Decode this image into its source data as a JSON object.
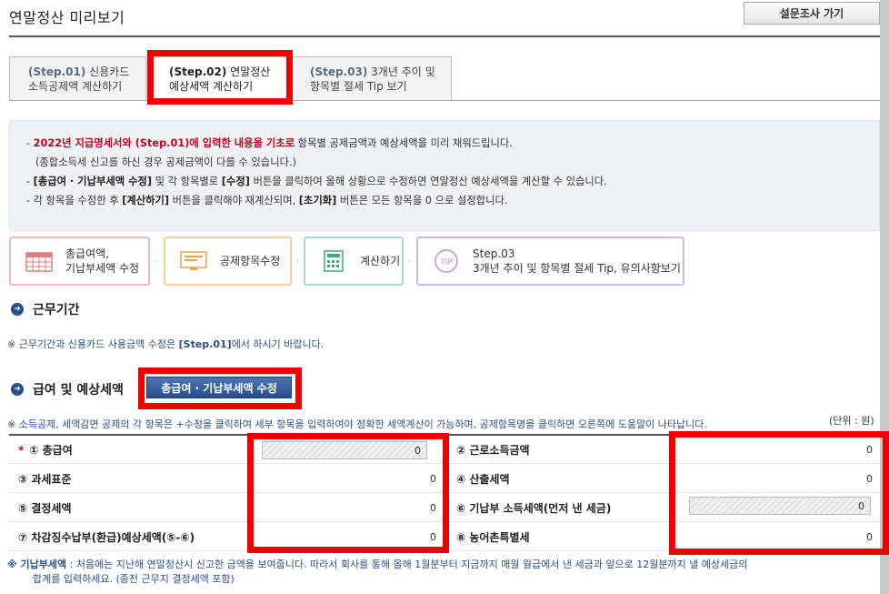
{
  "page": {
    "title": "연말정산 미리보기",
    "survey_button": "설문조사 가기"
  },
  "tabs": [
    {
      "step": "(Step.01)",
      "line1": "신용카드",
      "line2": "소득공제액 계산하기"
    },
    {
      "step": "(Step.02)",
      "line1": "연말정산",
      "line2": "예상세액 계산하기"
    },
    {
      "step": "(Step.03)",
      "line1": "3개년 추이 및",
      "line2": "항목별 절세 Tip 보기"
    }
  ],
  "notice": {
    "l1_red": "2022년 지급명세서와 (Step.01)에 입력한 내용을 기초로",
    "l1_rest": " 항목별 공제금액과 예상세액을 미리 채워드립니다.",
    "l2": "(종합소득세 신고를 하신 경우 공제금액이 다를 수 있습니다.)",
    "l3_b1": "[총급여 · 기납부세액 수정]",
    "l3_m1": " 및 각 항목별로 ",
    "l3_b2": "[수정]",
    "l3_rest": " 버튼을 클릭하여 올해 상황으로 수정하면 연말정산 예상세액을 계산할 수 있습니다.",
    "l4_a": "각 항목을 수정한 후 ",
    "l4_b1": "[계산하기]",
    "l4_m": " 버튼을 클릭해야 재계산되며, ",
    "l4_b2": "[초기화]",
    "l4_rest": " 버튼은 모든 항목을 0 으로 설정합니다."
  },
  "steps": [
    {
      "line1": "총급여액,",
      "line2": "기납부세액 수정",
      "color": "#f4b5b5"
    },
    {
      "line1": "공제항목수정",
      "line2": "",
      "color": "#f7cf9c"
    },
    {
      "line1": "계산하기",
      "line2": "",
      "color": "#a6dcc2"
    },
    {
      "line1": "Step.03",
      "line2": "3개년 추이 및 항목별 절세 Tip, 유의사항보기",
      "color": "#d3b6e8"
    }
  ],
  "step_icons": [
    "calendar-icon",
    "monitor-icon",
    "calculator-icon",
    "tip-icon"
  ],
  "work_period": {
    "title": "근무기간",
    "note_a": "※ 근무기간과 신용카드 사용금액 수정은 ",
    "note_b": "[Step.01]",
    "note_c": "에서 하시기 바랍니다."
  },
  "salary": {
    "title": "급여 및 예상세액",
    "edit_button": "총급여 · 기납부세액 수정",
    "note": "※ 소득공제, 세액감면 공제의 각 항목은 +수정을 클릭하여 세부 항목을 입력하여야 정확한 세액계산이 가능하며, 공제항목명을 클릭하면 오른쪽에 도움말이 나타납니다.",
    "unit": "(단위 : 원)"
  },
  "rows": {
    "r1_left": "① 총급여",
    "r1_left_val": "0",
    "r1_right": "② 근로소득금액",
    "r1_right_val": "0",
    "r2_left": "③ 과세표준",
    "r2_left_val": "0",
    "r2_right": "④ 산출세액",
    "r2_right_val": "0",
    "r3_left": "⑤ 결정세액",
    "r3_left_val": "0",
    "r3_right": "⑥ 기납부 소득세액(먼저 낸 세금)",
    "r3_right_val": "0",
    "r4_left": "⑦ 차감징수납부(환급)예상세액(⑤-⑥)",
    "r4_left_val": "0",
    "r4_right": "⑧ 농어촌특별세",
    "r4_right_val": "0",
    "required_mark": "*"
  },
  "footnote": {
    "label": "※ 기납부세액",
    "text1": " : 처음에는 지난해 연말정산시 신고한 금액을 보여줍니다. 따라서 회사를 통해 올해 1월분부터 지금까지 매월 월급에서 낸 세금과 앞으로 12월분까지 낼 예상세금의",
    "text2": "합계를 입력하세요. (종전 근무지 결정세액 포함)"
  },
  "colors": {
    "highlight": "#ee0000",
    "accent": "#2a4f8a",
    "red_text": "#c8001e"
  }
}
